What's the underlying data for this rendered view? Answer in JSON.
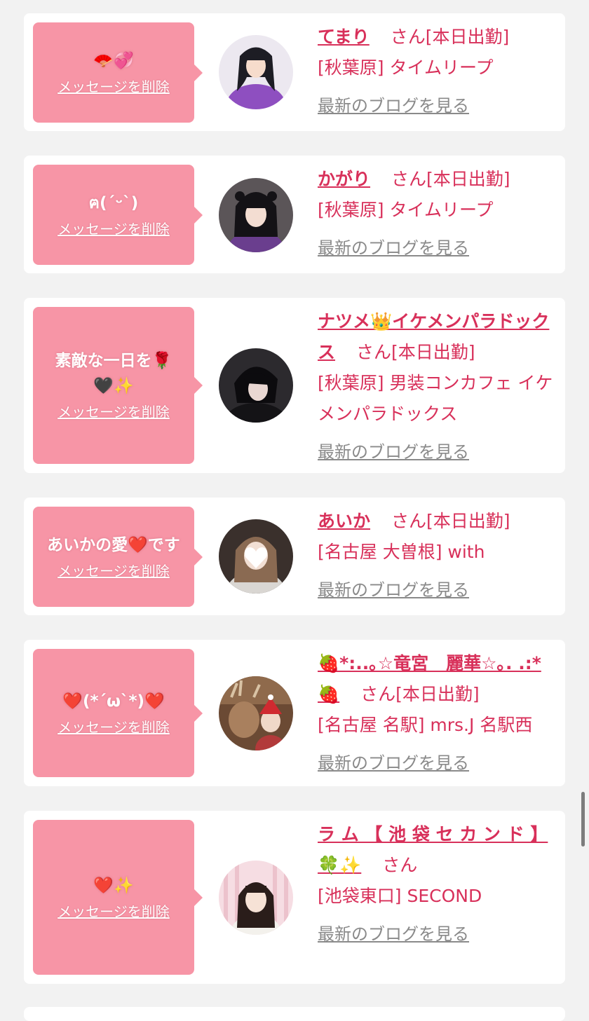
{
  "common": {
    "delete_label": "メッセージを削除",
    "blog_label": "最新のブログを見る",
    "san": "さん",
    "attend": "[本日出勤]",
    "accent_color": "#d8305a",
    "bubble_color": "#f795a6"
  },
  "cards": [
    {
      "message": "🪭💞",
      "name": "てまり",
      "attend": "[本日出勤]",
      "shop": "[秋葉原] タイムリープ",
      "avatar": "girl-purple-kimono"
    },
    {
      "message": "ฅ(ˊᵕˋ)",
      "name": "かがり",
      "attend": "[本日出勤]",
      "shop": "[秋葉原] タイムリープ",
      "avatar": "girl-black-twintails"
    },
    {
      "message": "素敵な一日を🌹🖤✨",
      "name": "ナツメ👑イケメンパラドックス",
      "attend": "[本日出勤]",
      "shop": "[秋葉原] 男装コンカフェ イケメンパラドックス",
      "avatar": "dark-hair-portrait"
    },
    {
      "message": "あいかの愛❤️です",
      "name": "あいか",
      "attend": "[本日出勤]",
      "shop": "[名古屋 大曽根] with",
      "avatar": "heart-face-portrait"
    },
    {
      "message": "❤️(*´ω`*)❤️",
      "name": "🍓*:..｡☆竜宮　麗華☆｡. .:*🍓",
      "attend": "[本日出勤]",
      "shop": "[名古屋 名駅] mrs.J 名駅西",
      "avatar": "reindeer-photo"
    },
    {
      "message": "❤️✨",
      "name": "ラ ム 【 池 袋 セ カ ン ド 】 🍀✨",
      "attend": "",
      "shop": "[池袋東口] SECOND",
      "avatar": "girl-pink-background"
    }
  ]
}
